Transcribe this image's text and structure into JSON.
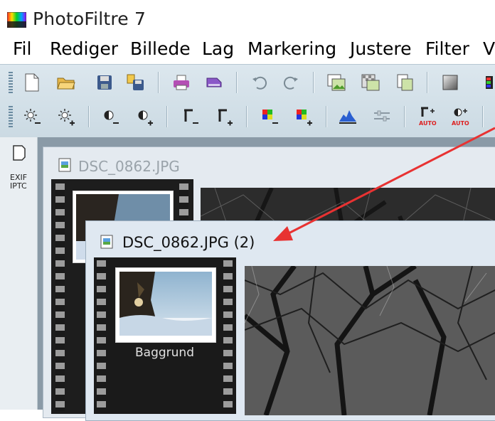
{
  "window": {
    "title": "PhotoFiltre 7",
    "icon": "photofiltre-app-icon"
  },
  "menu": {
    "items": [
      "Fil",
      "Rediger",
      "Billede",
      "Lag",
      "Markering",
      "Justere",
      "Filter",
      "V"
    ]
  },
  "toolbar": {
    "row1_icons": [
      "new-document-icon",
      "open-folder-icon",
      "save-icon",
      "save-as-icon",
      "print-icon",
      "scanner-icon",
      "undo-icon",
      "redo-icon",
      "image-copy-icon",
      "paste-icon",
      "document-icon",
      "gray-square-icon",
      "color-icon"
    ],
    "row2_icons": [
      "brightness-minus-icon",
      "brightness-plus-icon",
      "contrast-minus-icon",
      "contrast-plus-icon",
      "gamma-minus-icon",
      "gamma-plus-icon",
      "saturation-minus-icon",
      "saturation-plus-icon",
      "histogram-icon",
      "levels-icon",
      "auto-gamma-icon",
      "auto-contrast-icon"
    ],
    "auto_label": "AUTO"
  },
  "sidebar": {
    "exif_label_1": "EXIF",
    "exif_label_2": "IPTC"
  },
  "documents": [
    {
      "title": "DSC_0862.JPG"
    },
    {
      "title": "DSC_0862.JPG (2)",
      "layer_name": "Baggrund"
    }
  ],
  "colors": {
    "accent": "#e83232",
    "toolbar_bg": "#d3dfe7",
    "workspace": "#8a9aa7"
  }
}
